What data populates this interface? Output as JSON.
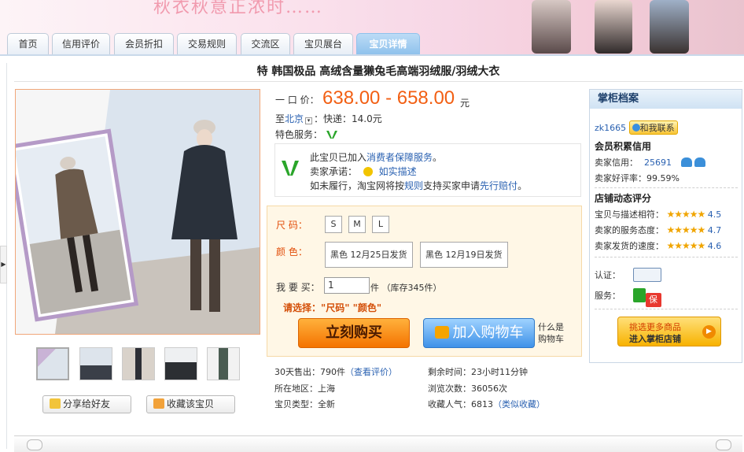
{
  "banner": {
    "slogan": "秋衣秋意正浓时……"
  },
  "nav": {
    "tabs": [
      "首页",
      "信用评价",
      "会员折扣",
      "交易规则",
      "交流区",
      "宝贝展台",
      "宝贝详情"
    ]
  },
  "product": {
    "title": "特  韩国极品  高绒含量獭兔毛高端羽绒服/羽绒大衣"
  },
  "price": {
    "label": "一 口 价：",
    "value": "638.00 - 658.00",
    "unit": "元",
    "ship_prefix": "至",
    "ship_city": "北京",
    "ship_suffix": "：快递：14.0元",
    "feature_label": "特色服务："
  },
  "service": {
    "line1_a": "此宝贝已加入",
    "line1_link": "消费者保障服务",
    "line1_b": "。",
    "line2_label": "卖家承诺：",
    "line2_link": "如实描述",
    "line3_a": "如未履行，淘宝网将按",
    "line3_link1": "规则",
    "line3_b": "支持买家申请",
    "line3_link2": "先行赔付",
    "line3_c": "。"
  },
  "options": {
    "size_label": "尺    码：",
    "sizes": [
      "S",
      "M",
      "L"
    ],
    "color_label": "颜    色：",
    "colors": [
      "黑色 12月25日发货",
      "黑色 12月19日发货"
    ],
    "qty_label": "我 要 买：",
    "qty_value": "1",
    "qty_suffix": "件 （库存345件）",
    "please": "请选择：\"尺码\" \"颜色\"",
    "buy": "立刻购买",
    "cart": "加入购物车",
    "cart_tip1": "什么是",
    "cart_tip2": "购物车"
  },
  "stats": {
    "sold": "30天售出：790件",
    "sold_link": "（查看评价）",
    "remaining": "剩余时间：23小时11分钟",
    "region": "所在地区：上海",
    "views": "浏览次数：36056次",
    "type": "宝贝类型：全新",
    "favs": "收藏人气：6813",
    "favs_link": "（类似收藏）"
  },
  "share": {
    "share": "分享给好友",
    "collect": "收藏该宝贝"
  },
  "seller": {
    "title": "掌柜档案",
    "name": "zk1665",
    "contact": "和我联系",
    "credit_head": "会员积累信用",
    "credit_label": "卖家信用：",
    "credit_value": "25691",
    "rate_label": "卖家好评率：",
    "rate_value": "99.59%",
    "dsr_head": "店铺动态评分",
    "dsr": [
      {
        "label": "宝贝与描述相符：",
        "score": "4.5"
      },
      {
        "label": "卖家的服务态度：",
        "score": "4.7"
      },
      {
        "label": "卖家发货的速度：",
        "score": "4.6"
      }
    ],
    "auth_label": "认证：",
    "service_label": "服务：",
    "service_badge": "保",
    "enter1": "挑选更多商品",
    "enter2": "进入掌柜店铺"
  },
  "colors": {
    "price": "#f25f13",
    "link": "#2a61b1",
    "accent": "#f47300"
  }
}
